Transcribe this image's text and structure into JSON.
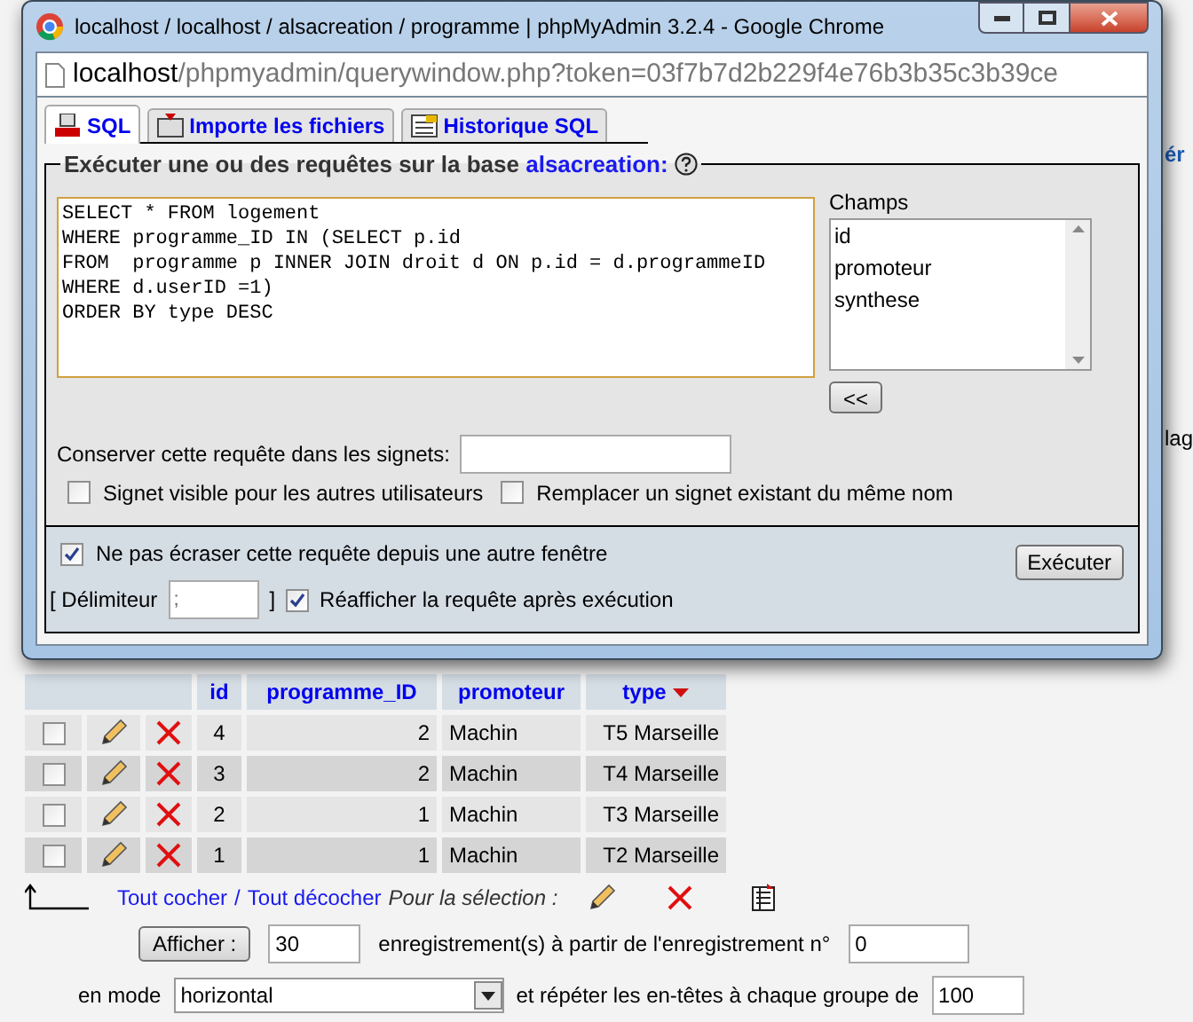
{
  "background_fragments": [
    "ér",
    "lag"
  ],
  "window": {
    "title": "localhost / localhost / alsacreation / programme | phpMyAdmin 3.2.4 - Google Chrome",
    "address": {
      "host": "localhost",
      "path": "/phpmyadmin/querywindow.php?token=03f7b7d2b229f4e76b3b35c3b39ce"
    }
  },
  "tabs": [
    {
      "label": "SQL",
      "selected": true
    },
    {
      "label": "Importe les fichiers",
      "selected": false
    },
    {
      "label": "Historique SQL",
      "selected": false
    }
  ],
  "query_panel": {
    "legend": "Exécuter une ou des requêtes sur la base ",
    "database": "alsacreation:",
    "query": "SELECT * FROM logement\nWHERE programme_ID IN (SELECT p.id\nFROM  programme p INNER JOIN droit d ON p.id = d.programmeID\nWHERE d.userID =1)\nORDER BY type DESC",
    "fields": {
      "label": "Champs",
      "items": [
        "id",
        "promoteur",
        "synthese"
      ],
      "insert_button": "<<"
    },
    "bookmark": {
      "label": "Conserver cette requête dans les signets:",
      "options": [
        {
          "label": "Signet visible pour les autres utilisateurs",
          "checked": false
        },
        {
          "label": "Remplacer un signet existant du même nom",
          "checked": false
        }
      ]
    }
  },
  "options": {
    "no_overwrite": {
      "label": "Ne pas écraser cette requête depuis une autre fenêtre",
      "checked": true
    },
    "delimiter_open": "[ Délimiteur",
    "delimiter": ";",
    "delimiter_close": "]",
    "show_again": {
      "label": "Réafficher la requête après exécution",
      "checked": true
    },
    "execute_button": "Exécuter"
  },
  "table": {
    "columns": [
      {
        "label": "id",
        "sorted": false
      },
      {
        "label": "programme_ID",
        "sorted": false
      },
      {
        "label": "promoteur",
        "sorted": false
      },
      {
        "label": "type",
        "sorted": true
      }
    ],
    "rows": [
      {
        "checked": false,
        "cells": [
          "4",
          "2",
          "Machin",
          "T5 Marseille"
        ]
      },
      {
        "checked": false,
        "cells": [
          "3",
          "2",
          "Machin",
          "T4 Marseille"
        ]
      },
      {
        "checked": false,
        "cells": [
          "2",
          "1",
          "Machin",
          "T3 Marseille"
        ]
      },
      {
        "checked": false,
        "cells": [
          "1",
          "1",
          "Machin",
          "T2 Marseille"
        ]
      }
    ]
  },
  "selection": {
    "check_all": "Tout cocher",
    "separator": "/",
    "uncheck_all": "Tout décocher",
    "with_selected": "Pour la sélection :"
  },
  "navigation": {
    "show_button": "Afficher :",
    "count": "30",
    "records_text": "enregistrement(s) à partir de l'enregistrement n°",
    "start": "0",
    "mode_label": "en mode",
    "mode": "horizontal",
    "repeat_text": "et répéter les en-têtes à chaque groupe de",
    "repeat": "100"
  }
}
